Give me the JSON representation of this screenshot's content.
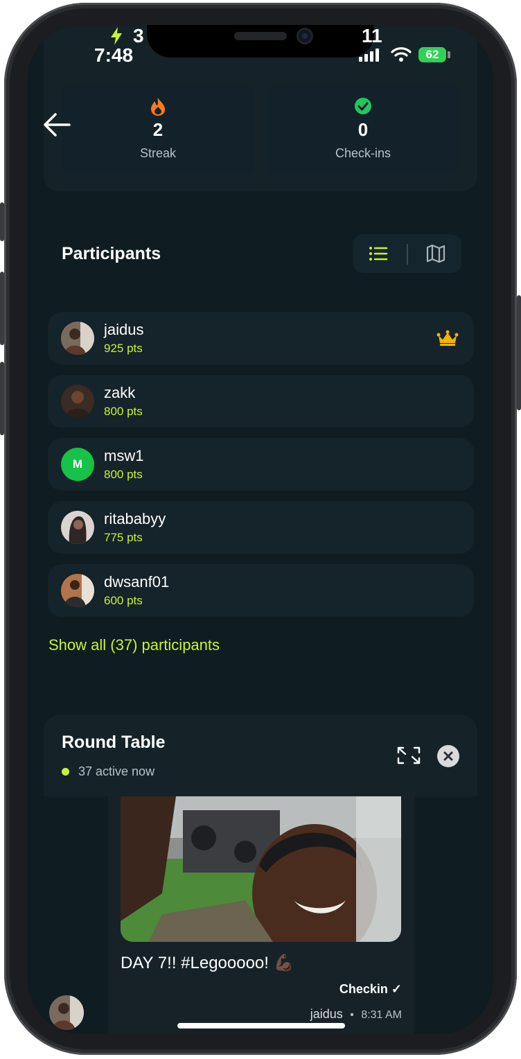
{
  "status_bar": {
    "time": "7:48",
    "left_badge": "3",
    "right_time": "11",
    "battery": "62"
  },
  "stats": [
    {
      "value": "2",
      "label": "Streak",
      "icon": "flame-icon"
    },
    {
      "value": "0",
      "label": "Check-ins",
      "icon": "check-circle-icon"
    }
  ],
  "participants": {
    "title": "Participants",
    "view_modes": [
      "list-icon",
      "map-icon"
    ],
    "items": [
      {
        "name": "jaidus",
        "points": "925 pts",
        "leader": true,
        "avatar_initial": ""
      },
      {
        "name": "zakk",
        "points": "800 pts",
        "leader": false,
        "avatar_initial": ""
      },
      {
        "name": "msw1",
        "points": "800 pts",
        "leader": false,
        "avatar_initial": "M"
      },
      {
        "name": "ritababyy",
        "points": "775 pts",
        "leader": false,
        "avatar_initial": ""
      },
      {
        "name": "dwsanf01",
        "points": "600 pts",
        "leader": false,
        "avatar_initial": ""
      }
    ],
    "show_all": "Show all (37) participants"
  },
  "round_table": {
    "title": "Round Table",
    "active": "37 active now",
    "message": {
      "text": "DAY 7!! #Legooooo! 💪🏿",
      "tag": "Checkin ✓",
      "author": "jaidus",
      "separator": "•",
      "time": "8:31 AM"
    }
  },
  "colors": {
    "accent": "#c6f432",
    "background": "#0f1c21",
    "card": "#152329",
    "crown": "#f5b400",
    "flame": "#ff7a1a",
    "check": "#22c55e"
  }
}
